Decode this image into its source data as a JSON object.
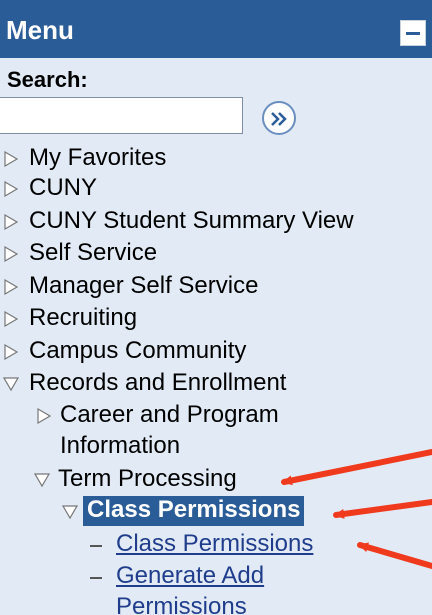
{
  "menu": {
    "title": "Menu",
    "search_label": "Search:",
    "search_value": "",
    "search_placeholder": ""
  },
  "tree": {
    "top_items": [
      {
        "label": "My Favorites"
      },
      {
        "label": "CUNY"
      },
      {
        "label": "CUNY Student Summary View"
      },
      {
        "label": "Self Service"
      },
      {
        "label": "Manager Self Service"
      },
      {
        "label": "Recruiting"
      },
      {
        "label": "Campus Community"
      },
      {
        "label": "Records and Enrollment"
      }
    ],
    "career_line1": "Career and Program",
    "career_line2": "Information",
    "term_processing": "Term Processing",
    "class_permissions_folder": "Class Permissions",
    "class_permissions_link": "Class Permissions",
    "generate_line1": "Generate Add",
    "generate_line2": "Permissions"
  },
  "colors": {
    "header": "#2a5c98",
    "panel_bg": "#e2ebf5",
    "link": "#1f3d8c",
    "annotation_arrow": "#f03a1e"
  }
}
